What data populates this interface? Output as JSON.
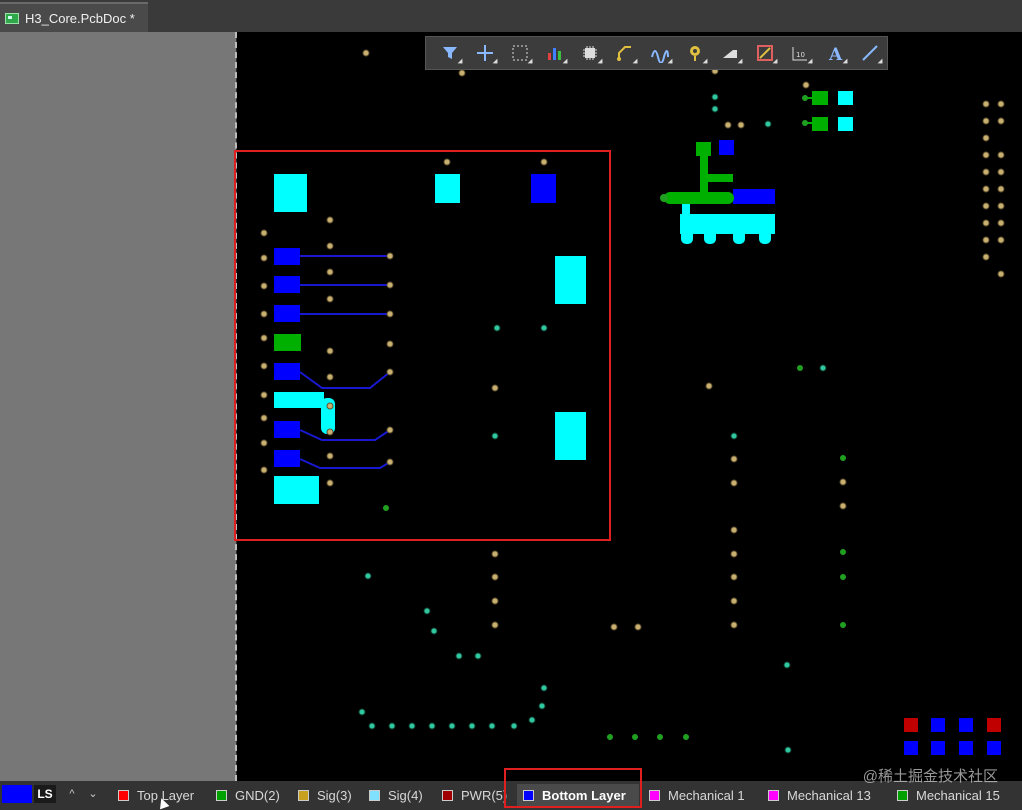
{
  "document_tab": {
    "title": "H3_Core.PcbDoc *"
  },
  "toolbar": {
    "tools": [
      "filter-icon",
      "crosshair-icon",
      "select-rect-icon",
      "chart-icon",
      "component-icon",
      "route-icon",
      "interactive-route-icon",
      "via-icon",
      "fill-icon",
      "polygon-icon",
      "dimension-icon",
      "text-icon",
      "line-icon"
    ]
  },
  "layer_bar": {
    "current_swatch_color": "#0000ff",
    "current_label": "LS",
    "up_arrow": "^",
    "down_arrow": "⌄",
    "tabs": [
      {
        "label": "Top Layer",
        "color": "#ff0000"
      },
      {
        "label": "GND(2)",
        "color": "#00a000"
      },
      {
        "label": "Sig(3)",
        "color": "#c8a020"
      },
      {
        "label": "Sig(4)",
        "color": "#80e0ff"
      },
      {
        "label": "PWR(5)",
        "color": "#a00000"
      },
      {
        "label": "Bottom Layer",
        "color": "#0000ff",
        "active": true
      },
      {
        "label": "Mechanical 1",
        "color": "#ff00ff"
      },
      {
        "label": "Mechanical 13",
        "color": "#ff00ff"
      },
      {
        "label": "Mechanical 15",
        "color": "#00a000"
      }
    ]
  },
  "watermark": "@稀土掘金技术社区",
  "colors": {
    "top_layer_pad": "#0000ff",
    "bottom_layer_pad": "#00ffff",
    "gnd": "#00c000",
    "via": "#c8b060"
  }
}
